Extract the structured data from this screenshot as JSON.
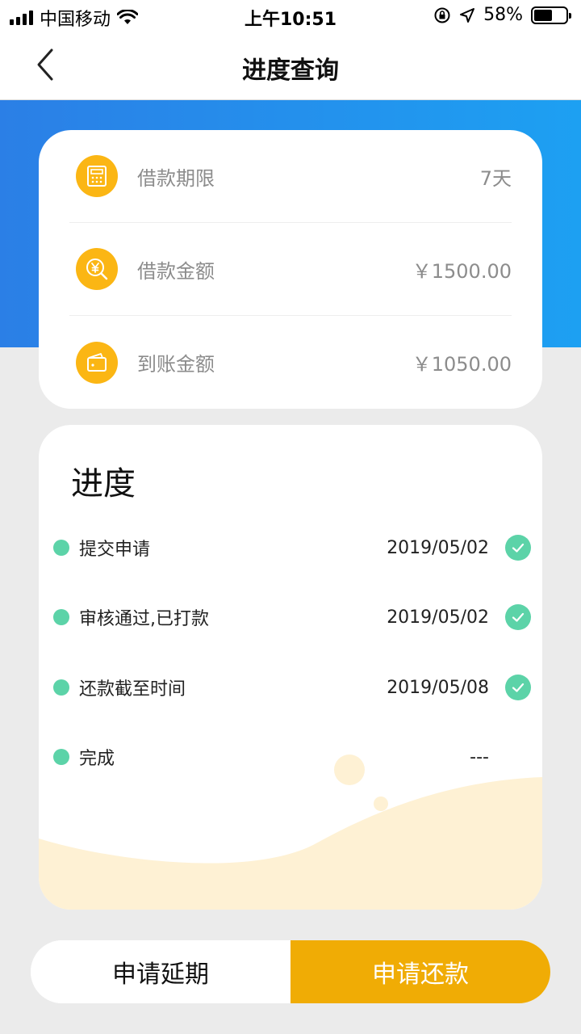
{
  "status_bar": {
    "carrier": "中国移动",
    "time": "上午10:51",
    "battery": "58%",
    "battery_level": 0.58,
    "icons": [
      "signal-icon",
      "wifi-icon",
      "rotation-lock-icon",
      "location-icon",
      "battery-icon"
    ]
  },
  "nav": {
    "title": "进度查询",
    "back_icon": "chevron-left-icon"
  },
  "loan_info": [
    {
      "label": "借款期限",
      "value": "7天",
      "icon": "calculator-icon"
    },
    {
      "label": "借款金额",
      "value": "￥1500.00",
      "icon": "yen-search-icon"
    },
    {
      "label": "到账金额",
      "value": "￥1050.00",
      "icon": "wallet-icon"
    }
  ],
  "progress": {
    "title": "进度",
    "steps": [
      {
        "label": "提交申请",
        "date": "2019/05/02",
        "done": true
      },
      {
        "label": "审核通过,已打款",
        "date": "2019/05/02",
        "done": true
      },
      {
        "label": "还款截至时间",
        "date": "2019/05/08",
        "done": true
      },
      {
        "label": "完成",
        "date": "---",
        "done": false
      }
    ]
  },
  "actions": {
    "extend_label": "申请延期",
    "repay_label": "申请还款"
  },
  "colors": {
    "accent_blue": "#2b7fe6",
    "accent_yellow": "#fbb614",
    "button_yellow": "#f0ac05",
    "step_green": "#5cd3a8",
    "wave_cream": "#fef1d4"
  }
}
